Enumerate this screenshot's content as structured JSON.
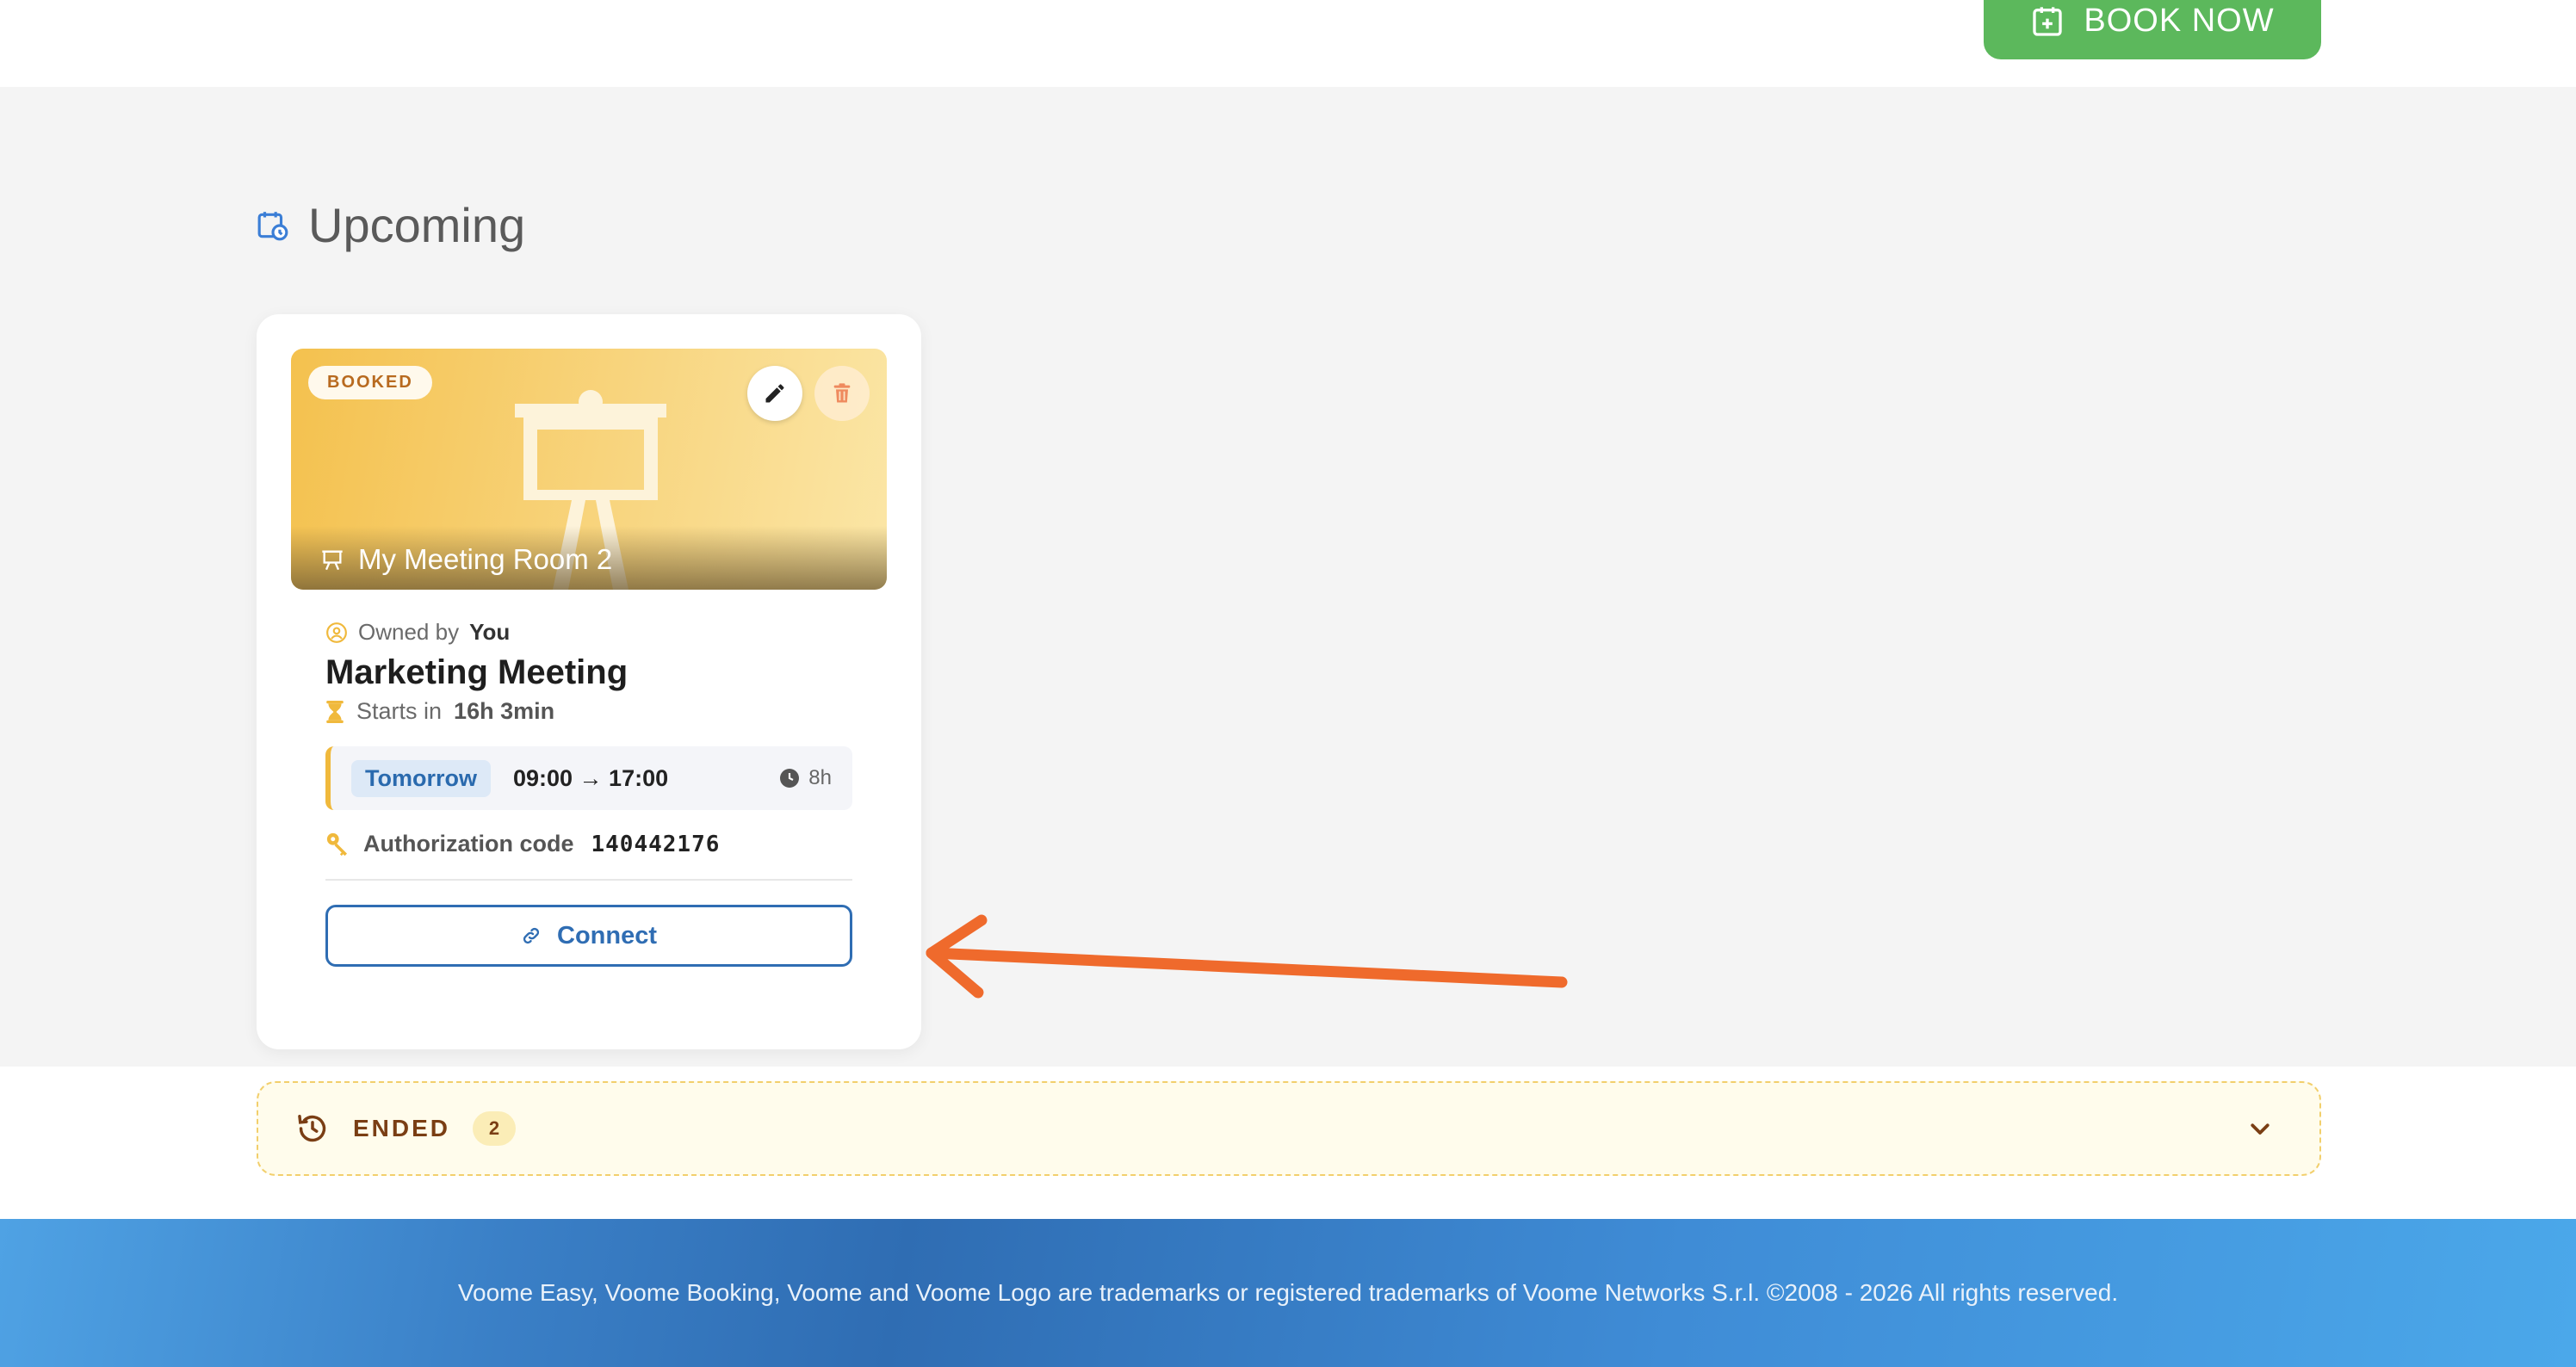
{
  "header": {
    "book_button_label": "BOOK NOW"
  },
  "upcoming": {
    "title": "Upcoming",
    "card": {
      "status_badge": "BOOKED",
      "room_name": "My Meeting Room 2",
      "owner_prefix": "Owned by",
      "owner": "You",
      "meeting_title": "Marketing Meeting",
      "starts_prefix": "Starts in",
      "starts_in": "16h 3min",
      "day": "Tomorrow",
      "time_range": "09:00 → 17:00",
      "duration": "8h",
      "auth_label": "Authorization code",
      "auth_code": "140442176",
      "connect_label": "Connect"
    }
  },
  "ended": {
    "label": "ENDED",
    "count": "2"
  },
  "footer": {
    "text": "Voome Easy, Voome Booking, Voome and Voome Logo are trademarks or registered trademarks of Voome Networks S.r.l. ©2008 - 2026 All rights reserved."
  },
  "colors": {
    "accent_green": "#5cb85c",
    "accent_blue": "#2f6db3",
    "highlight_yellow": "#f0b93c",
    "arrow_orange": "#ef6a2c",
    "ended_text": "#7a3e14"
  },
  "icons": [
    "calendar-add-icon",
    "calendar-clock-icon",
    "presentation-board-icon",
    "pencil-icon",
    "trash-icon",
    "user-circle-icon",
    "hourglass-icon",
    "clock-icon",
    "key-icon",
    "link-icon",
    "history-icon",
    "chevron-down-icon"
  ]
}
